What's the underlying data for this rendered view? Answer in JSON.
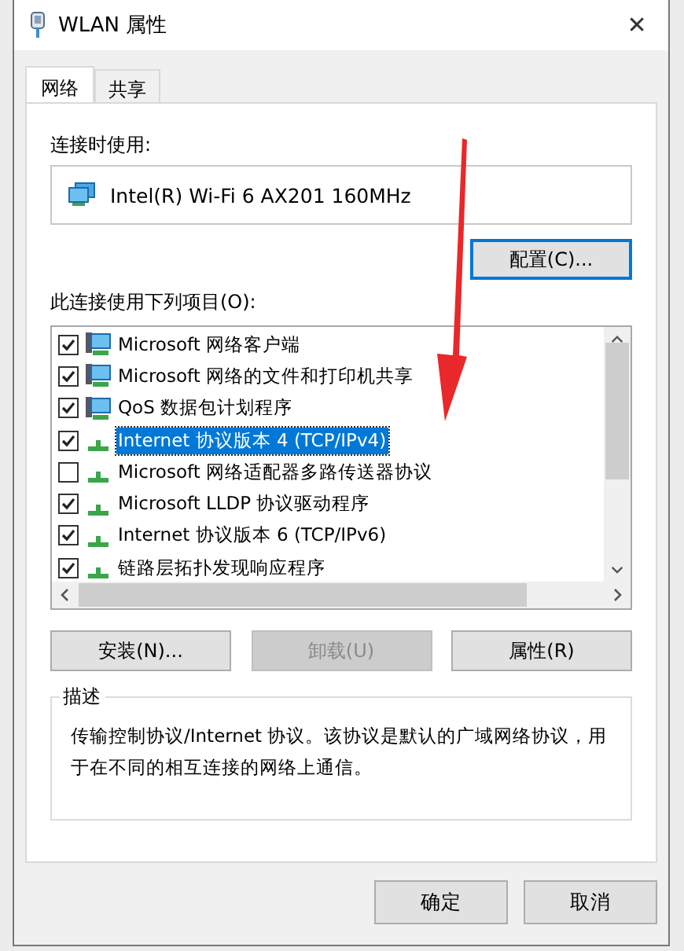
{
  "window": {
    "title": "WLAN 属性",
    "close": "✕"
  },
  "tabs": [
    {
      "label": "网络",
      "selected": true
    },
    {
      "label": "共享",
      "selected": false
    }
  ],
  "connect_using": {
    "label": "连接时使用:",
    "adapter": "Intel(R) Wi-Fi 6 AX201 160MHz",
    "configure_button": "配置(C)..."
  },
  "items_label": "此连接使用下列项目(O):",
  "items": [
    {
      "kind": "service",
      "label": "Microsoft 网络客户端",
      "checked": true,
      "selected": false
    },
    {
      "kind": "service",
      "label": "Microsoft 网络的文件和打印机共享",
      "checked": true,
      "selected": false
    },
    {
      "kind": "service",
      "label": "QoS 数据包计划程序",
      "checked": true,
      "selected": false
    },
    {
      "kind": "protocol",
      "label": "Internet 协议版本 4 (TCP/IPv4)",
      "checked": true,
      "selected": true
    },
    {
      "kind": "protocol",
      "label": "Microsoft 网络适配器多路传送器协议",
      "checked": false,
      "selected": false
    },
    {
      "kind": "protocol",
      "label": "Microsoft LLDP 协议驱动程序",
      "checked": true,
      "selected": false
    },
    {
      "kind": "protocol",
      "label": "Internet 协议版本 6 (TCP/IPv6)",
      "checked": true,
      "selected": false
    },
    {
      "kind": "protocol",
      "label": "链路层拓扑发现响应程序",
      "checked": true,
      "selected": false
    }
  ],
  "item_buttons": [
    {
      "label": "安装(N)...",
      "disabled": false
    },
    {
      "label": "卸载(U)",
      "disabled": true
    },
    {
      "label": "属性(R)",
      "disabled": false
    }
  ],
  "description": {
    "title": "描述",
    "text": "传输控制协议/Internet 协议。该协议是默认的广域网络协议，用于在不同的相互连接的网络上通信。"
  },
  "dialog_buttons": [
    "确定",
    "取消"
  ]
}
